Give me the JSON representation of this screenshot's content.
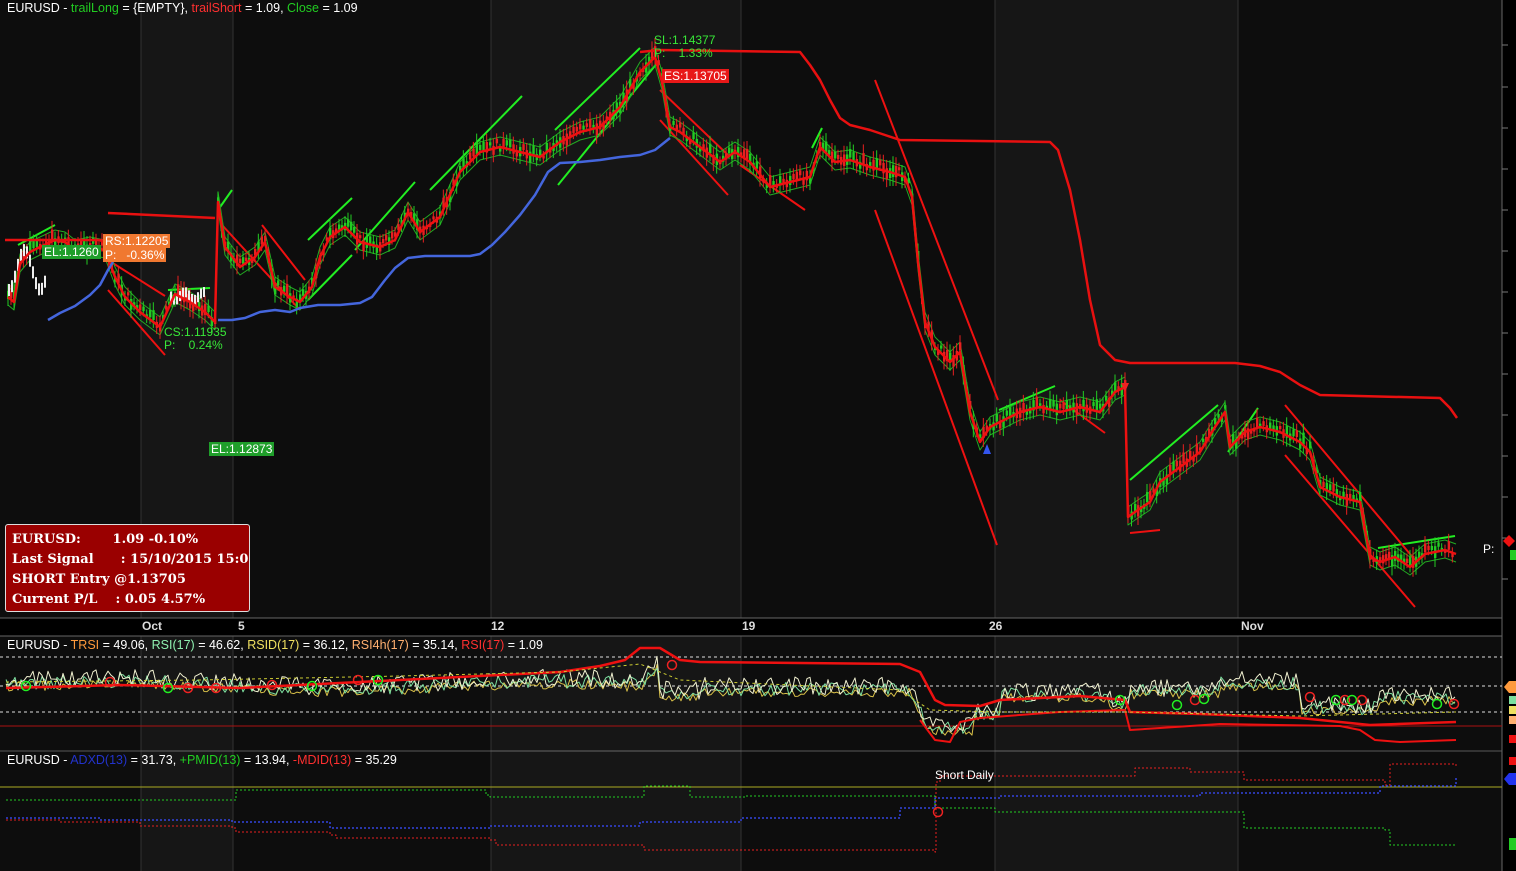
{
  "headers": {
    "main": [
      {
        "text": "EURUSD - ",
        "color": "#ffffff"
      },
      {
        "text": "trailLong",
        "color": "#22cc22"
      },
      {
        "text": " = {EMPTY}, ",
        "color": "#ffffff"
      },
      {
        "text": "trailShort",
        "color": "#ff3030"
      },
      {
        "text": " = 1.09, ",
        "color": "#ffffff"
      },
      {
        "text": "Close",
        "color": "#22cc22"
      },
      {
        "text": " = 1.09",
        "color": "#ffffff"
      }
    ],
    "rsi": [
      {
        "text": "EURUSD - ",
        "color": "#ffffff"
      },
      {
        "text": "TRSI",
        "color": "#ff9a3c"
      },
      {
        "text": " = 49.06, ",
        "color": "#ffffff"
      },
      {
        "text": "RSI(17)",
        "color": "#8ff0b0"
      },
      {
        "text": " = 46.62, ",
        "color": "#ffffff"
      },
      {
        "text": "RSID(17)",
        "color": "#f0e060"
      },
      {
        "text": " = 36.12, ",
        "color": "#ffffff"
      },
      {
        "text": "RSI4h(17)",
        "color": "#ffb070"
      },
      {
        "text": " = 35.14, ",
        "color": "#ffffff"
      },
      {
        "text": "RSI(17)",
        "color": "#ff3030"
      },
      {
        "text": " = 1.09",
        "color": "#ffffff"
      }
    ],
    "adx": [
      {
        "text": "EURUSD - ",
        "color": "#ffffff"
      },
      {
        "text": "ADXD(13)",
        "color": "#2233cc"
      },
      {
        "text": " = 31.73, ",
        "color": "#ffffff"
      },
      {
        "text": "+PMID(13)",
        "color": "#22cc22"
      },
      {
        "text": " = 13.94, ",
        "color": "#ffffff"
      },
      {
        "text": "-MDID(13)",
        "color": "#ff3030"
      },
      {
        "text": " = 35.29",
        "color": "#ffffff"
      }
    ]
  },
  "x_axis_labels": [
    "Oct",
    "5",
    "12",
    "19",
    "26",
    "Nov"
  ],
  "signal_labels": {
    "el1": "EL:1.1260",
    "rs1": "RS:1.12205",
    "rs1_p": "P:   -0.36%",
    "cs1": "CS:1.11935",
    "cs1_p": "P:    0.24%",
    "el2": "EL:1.12873",
    "sl1": "SL:1.14377",
    "sl1_p": "P:    1.33%",
    "es1": "ES:1.13705",
    "right_p": "P:"
  },
  "info_box": {
    "line1": "EURUSD:       1.09 -0.10%",
    "line2": "Last Signal      : 15/10/2015 15:0",
    "line3": "SHORT Entry @1.13705",
    "line4": "Current P/L    : 0.05 4.57%"
  },
  "annotation_short_daily": "Short Daily",
  "colors": {
    "background": "#000000",
    "panel_bg": "#0a0a0a",
    "shade": "#1a1a1a",
    "grid": "#3a3a3a",
    "trail_short": "#e81010",
    "trail_long": "#4466dd",
    "channel_up": "#22ee22",
    "channel_down": "#ee1111",
    "info_bg": "#9a0000"
  },
  "chart_data": [
    {
      "type": "line",
      "name": "price panel",
      "x_axis": [
        "Oct",
        "5",
        "12",
        "19",
        "26",
        "Nov"
      ],
      "series": [
        {
          "name": "trailShort",
          "color": "#e81010",
          "values": [
            1.12,
            1.121,
            1.121,
            1.14,
            1.14,
            1.137,
            1.135,
            1.135,
            1.134,
            1.126,
            1.117,
            1.114,
            1.112
          ]
        },
        {
          "name": "trailLong",
          "color": "#4466dd",
          "values": [
            1.112,
            1.114,
            1.115,
            1.118,
            1.121,
            1.129,
            1.134
          ]
        }
      ],
      "markers": [
        "EL:1.1260",
        "RS:1.12205",
        "CS:1.11935",
        "EL:1.12873",
        "SL:1.14377",
        "ES:1.13705"
      ]
    },
    {
      "type": "line",
      "name": "RSI panel",
      "series": [
        {
          "name": "TRSI",
          "value": 49.06
        },
        {
          "name": "RSI(17)",
          "value": 46.62
        },
        {
          "name": "RSID(17)",
          "value": 36.12
        },
        {
          "name": "RSI4h(17)",
          "value": 35.14
        },
        {
          "name": "RSI(17)",
          "value": 1.09
        }
      ]
    },
    {
      "type": "line",
      "name": "ADX panel",
      "series": [
        {
          "name": "ADXD(13)",
          "value": 31.73
        },
        {
          "name": "+PMID(13)",
          "value": 13.94
        },
        {
          "name": "-MDID(13)",
          "value": 35.29
        }
      ]
    }
  ]
}
